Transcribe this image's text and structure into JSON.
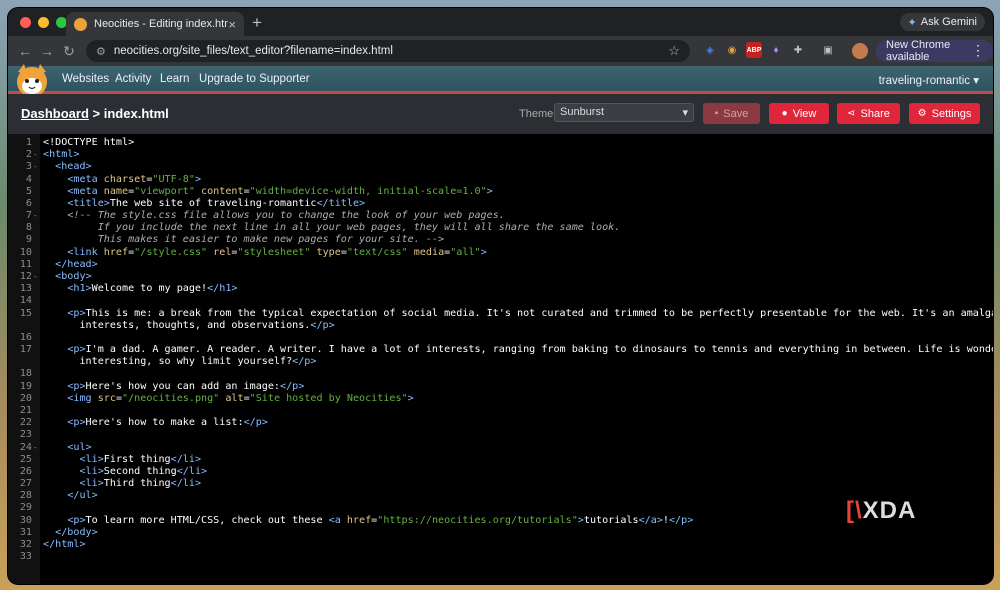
{
  "browser": {
    "tab_title": "Neocities - Editing index.html",
    "url": "neocities.org/site_files/text_editor?filename=index.html",
    "gemini_label": "Ask Gemini",
    "update_label": "New Chrome available"
  },
  "nav": {
    "items": [
      "Websites",
      "Activity",
      "Learn",
      "Upgrade to Supporter"
    ],
    "site_name": "traveling-romantic"
  },
  "editbar": {
    "crumb_link": "Dashboard",
    "crumb_sep": ">",
    "crumb_file": "index.html",
    "theme_label": "Theme:",
    "theme_value": "Sunburst",
    "save_label": "Save",
    "view_label": "View",
    "share_label": "Share",
    "settings_label": "Settings"
  },
  "colors": {
    "tag": "#89bdff",
    "attr": "#e0c589",
    "string": "#65b042",
    "comment": "#aeaeae",
    "button_red": "#e0263a",
    "nav_bg": "#3d6470"
  },
  "code": [
    {
      "n": "1",
      "f": false,
      "t": [
        [
          "dt",
          "<!DOCTYPE html>"
        ]
      ]
    },
    {
      "n": "2",
      "f": true,
      "t": [
        [
          "tg",
          "<html>"
        ]
      ]
    },
    {
      "n": "3",
      "f": true,
      "t": [
        [
          "",
          "  "
        ],
        [
          "tg",
          "<head>"
        ]
      ]
    },
    {
      "n": "4",
      "f": false,
      "t": [
        [
          "",
          "    "
        ],
        [
          "tg",
          "<meta "
        ],
        [
          "at",
          "charset"
        ],
        [
          "",
          "="
        ],
        [
          "st",
          "\"UTF-8\""
        ],
        [
          "tg",
          ">"
        ]
      ]
    },
    {
      "n": "5",
      "f": false,
      "t": [
        [
          "",
          "    "
        ],
        [
          "tg",
          "<meta "
        ],
        [
          "at",
          "name"
        ],
        [
          "",
          "="
        ],
        [
          "st",
          "\"viewport\""
        ],
        [
          "at",
          " content"
        ],
        [
          "",
          "="
        ],
        [
          "st",
          "\"width=device-width, initial-scale=1.0\""
        ],
        [
          "tg",
          ">"
        ]
      ]
    },
    {
      "n": "6",
      "f": false,
      "t": [
        [
          "",
          "    "
        ],
        [
          "tg",
          "<title>"
        ],
        [
          "",
          "The web site of traveling-romantic"
        ],
        [
          "tg",
          "</title>"
        ]
      ]
    },
    {
      "n": "7",
      "f": true,
      "t": [
        [
          "",
          "    "
        ],
        [
          "cm",
          "<!-- The style.css file allows you to change the look of your web pages."
        ]
      ]
    },
    {
      "n": "8",
      "f": false,
      "t": [
        [
          "cm",
          "         If you include the next line in all your web pages, they will all share the same look."
        ]
      ]
    },
    {
      "n": "9",
      "f": false,
      "t": [
        [
          "cm",
          "         This makes it easier to make new pages for your site. -->"
        ]
      ]
    },
    {
      "n": "10",
      "f": false,
      "t": [
        [
          "",
          "    "
        ],
        [
          "tg",
          "<link "
        ],
        [
          "at",
          "href"
        ],
        [
          "",
          "="
        ],
        [
          "st",
          "\"/style.css\""
        ],
        [
          "at",
          " rel"
        ],
        [
          "",
          "="
        ],
        [
          "st",
          "\"stylesheet\""
        ],
        [
          "at",
          " type"
        ],
        [
          "",
          "="
        ],
        [
          "st",
          "\"text/css\""
        ],
        [
          "at",
          " media"
        ],
        [
          "",
          "="
        ],
        [
          "st",
          "\"all\""
        ],
        [
          "tg",
          ">"
        ]
      ]
    },
    {
      "n": "11",
      "f": false,
      "t": [
        [
          "",
          "  "
        ],
        [
          "tg",
          "</head>"
        ]
      ]
    },
    {
      "n": "12",
      "f": true,
      "t": [
        [
          "",
          "  "
        ],
        [
          "tg",
          "<body>"
        ]
      ]
    },
    {
      "n": "13",
      "f": false,
      "t": [
        [
          "",
          "    "
        ],
        [
          "tg",
          "<h1>"
        ],
        [
          "",
          "Welcome to my page!"
        ],
        [
          "tg",
          "</h1>"
        ]
      ]
    },
    {
      "n": "14",
      "f": false,
      "t": []
    },
    {
      "n": "15",
      "f": false,
      "t": [
        [
          "",
          "    "
        ],
        [
          "tg",
          "<p>"
        ],
        [
          "",
          "This is me: a break from the typical expectation of social media. It's not curated and trimmed to be perfectly presentable for the web. It's an amalgamation of my"
        ]
      ]
    },
    {
      "n": "",
      "f": false,
      "t": [
        [
          "",
          "      interests, thoughts, and observations."
        ],
        [
          "tg",
          "</p>"
        ]
      ]
    },
    {
      "n": "16",
      "f": false,
      "t": []
    },
    {
      "n": "17",
      "f": false,
      "t": [
        [
          "",
          "    "
        ],
        [
          "tg",
          "<p>"
        ],
        [
          "",
          "I'm a dad. A gamer. A reader. A writer. I have a lot of interests, ranging from baking to dinosaurs to tennis and everything in between. Life is wonderful and"
        ]
      ]
    },
    {
      "n": "",
      "f": false,
      "t": [
        [
          "",
          "      interesting, so why limit yourself?"
        ],
        [
          "tg",
          "</p>"
        ]
      ]
    },
    {
      "n": "18",
      "f": false,
      "t": []
    },
    {
      "n": "19",
      "f": false,
      "t": [
        [
          "",
          "    "
        ],
        [
          "tg",
          "<p>"
        ],
        [
          "",
          "Here's how you can add an image:"
        ],
        [
          "tg",
          "</p>"
        ]
      ]
    },
    {
      "n": "20",
      "f": false,
      "t": [
        [
          "",
          "    "
        ],
        [
          "tg",
          "<img "
        ],
        [
          "at",
          "src"
        ],
        [
          "",
          "="
        ],
        [
          "st",
          "\"/neocities.png\""
        ],
        [
          "at",
          " alt"
        ],
        [
          "",
          "="
        ],
        [
          "st",
          "\"Site hosted by Neocities\""
        ],
        [
          "tg",
          ">"
        ]
      ]
    },
    {
      "n": "21",
      "f": false,
      "t": []
    },
    {
      "n": "22",
      "f": false,
      "t": [
        [
          "",
          "    "
        ],
        [
          "tg",
          "<p>"
        ],
        [
          "",
          "Here's how to make a list:"
        ],
        [
          "tg",
          "</p>"
        ]
      ]
    },
    {
      "n": "23",
      "f": false,
      "t": []
    },
    {
      "n": "24",
      "f": true,
      "t": [
        [
          "",
          "    "
        ],
        [
          "tg",
          "<ul>"
        ]
      ]
    },
    {
      "n": "25",
      "f": false,
      "t": [
        [
          "",
          "      "
        ],
        [
          "tg",
          "<li>"
        ],
        [
          "",
          "First thing"
        ],
        [
          "tg",
          "</li>"
        ]
      ]
    },
    {
      "n": "26",
      "f": false,
      "t": [
        [
          "",
          "      "
        ],
        [
          "tg",
          "<li>"
        ],
        [
          "",
          "Second thing"
        ],
        [
          "tg",
          "</li>"
        ]
      ]
    },
    {
      "n": "27",
      "f": false,
      "t": [
        [
          "",
          "      "
        ],
        [
          "tg",
          "<li>"
        ],
        [
          "",
          "Third thing"
        ],
        [
          "tg",
          "</li>"
        ]
      ]
    },
    {
      "n": "28",
      "f": false,
      "t": [
        [
          "",
          "    "
        ],
        [
          "tg",
          "</ul>"
        ]
      ]
    },
    {
      "n": "29",
      "f": false,
      "t": []
    },
    {
      "n": "30",
      "f": false,
      "t": [
        [
          "",
          "    "
        ],
        [
          "tg",
          "<p>"
        ],
        [
          "",
          "To learn more HTML/CSS, check out these "
        ],
        [
          "tg",
          "<a "
        ],
        [
          "at",
          "href"
        ],
        [
          "",
          "="
        ],
        [
          "st",
          "\"https://neocities.org/tutorials\""
        ],
        [
          "tg",
          ">"
        ],
        [
          "",
          "tutorials"
        ],
        [
          "tg",
          "</a>"
        ],
        [
          "",
          "!"
        ],
        [
          "tg",
          "</p>"
        ]
      ]
    },
    {
      "n": "31",
      "f": false,
      "t": [
        [
          "",
          "  "
        ],
        [
          "tg",
          "</body>"
        ]
      ]
    },
    {
      "n": "32",
      "f": false,
      "t": [
        [
          "tg",
          "</html>"
        ]
      ]
    },
    {
      "n": "33",
      "f": false,
      "t": []
    }
  ],
  "watermark": "XDA"
}
